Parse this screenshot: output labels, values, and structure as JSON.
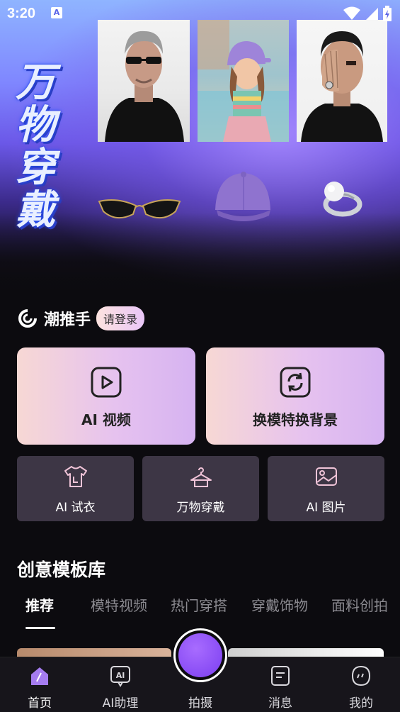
{
  "status_bar": {
    "time": "3:20",
    "app_badge": "A"
  },
  "hero": {
    "title": "万物穿戴",
    "photos": [
      "man-sunglasses-photo",
      "girl-cap-photo",
      "man-ring-photo"
    ],
    "products": [
      "sunglasses-product",
      "cap-product",
      "ring-product"
    ]
  },
  "user": {
    "brand_name": "潮推手",
    "login_label": "请登录"
  },
  "feature_cards": [
    {
      "label": "AI 视频",
      "icon": "play-video-icon"
    },
    {
      "label": "换模特换背景",
      "icon": "refresh-icon"
    }
  ],
  "tools": [
    {
      "label": "AI 试衣",
      "icon": "tshirt-icon"
    },
    {
      "label": "万物穿戴",
      "icon": "hanger-icon"
    },
    {
      "label": "AI 图片",
      "icon": "image-icon"
    }
  ],
  "template_section": {
    "title": "创意模板库",
    "tabs": [
      "推荐",
      "模特视频",
      "热门穿搭",
      "穿戴饰物",
      "面料创拍"
    ],
    "active_tab": "推荐"
  },
  "bottom_nav": {
    "items": [
      {
        "label": "首页",
        "icon": "home-icon"
      },
      {
        "label": "AI助理",
        "icon": "ai-assistant-icon"
      },
      {
        "label": "拍摄",
        "icon": "camera-shoot-button"
      },
      {
        "label": "消息",
        "icon": "message-icon"
      },
      {
        "label": "我的",
        "icon": "profile-icon"
      }
    ],
    "active": "首页"
  },
  "colors": {
    "accent_purple": "#8b4cf5",
    "card_gradient_start": "#f7d8d4",
    "card_gradient_end": "#d6b3f1",
    "tool_card_bg": "#3d3645",
    "background": "#0c0b0f"
  }
}
